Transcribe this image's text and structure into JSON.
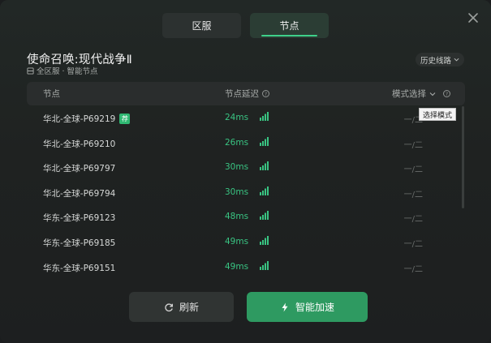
{
  "tabs": [
    {
      "label": "区服",
      "active": false
    },
    {
      "label": "节点",
      "active": true
    }
  ],
  "game": {
    "title": "使命召唤:现代战争Ⅱ",
    "subtitle": "全区服 · 智能节点"
  },
  "history_button": {
    "label": "历史线路"
  },
  "table": {
    "headers": {
      "node": "节点",
      "latency": "节点延迟",
      "mode": "模式选择"
    },
    "rows": [
      {
        "name": "华北-全球-P69219",
        "badge": "荐",
        "latency": "24ms",
        "mode": "一/二"
      },
      {
        "name": "华北-全球-P69210",
        "badge": "",
        "latency": "26ms",
        "mode": "一/二"
      },
      {
        "name": "华北-全球-P69797",
        "badge": "",
        "latency": "30ms",
        "mode": "一/二"
      },
      {
        "name": "华北-全球-P69794",
        "badge": "",
        "latency": "30ms",
        "mode": "一/二"
      },
      {
        "name": "华东-全球-P69123",
        "badge": "",
        "latency": "48ms",
        "mode": "一/二"
      },
      {
        "name": "华东-全球-P69185",
        "badge": "",
        "latency": "49ms",
        "mode": "一/二"
      },
      {
        "name": "华东-全球-P69151",
        "badge": "",
        "latency": "49ms",
        "mode": "一/二"
      }
    ]
  },
  "tooltip": {
    "text": "选择模式"
  },
  "buttons": {
    "refresh": "刷新",
    "boost": "智能加速"
  },
  "colors": {
    "accent": "#2e9a61",
    "latency": "#39c482",
    "background": "#1f2221"
  },
  "icons": {
    "close": "close-icon",
    "refresh": "refresh-icon",
    "boost": "lightning-icon",
    "signal": "signal-icon"
  }
}
